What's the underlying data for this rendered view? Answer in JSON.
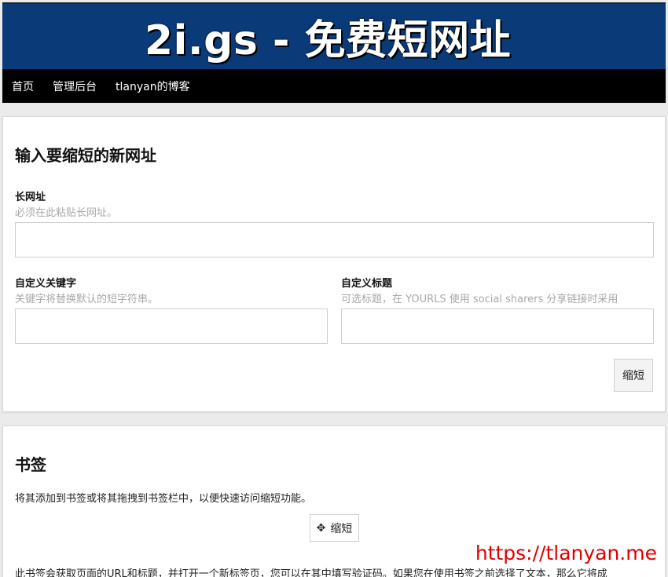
{
  "header": {
    "site_title": "2i.gs - 免费短网址",
    "nav": [
      "首页",
      "管理后台",
      "tlanyan的博客"
    ]
  },
  "shorten_form": {
    "heading": "输入要缩短的新网址",
    "long_url": {
      "label": "长网址",
      "help": "必须在此粘贴长网址。",
      "value": ""
    },
    "keyword": {
      "label": "自定义关键字",
      "help": "关键字将替换默认的短字符串。",
      "value": ""
    },
    "title": {
      "label": "自定义标题",
      "help": "可选标题，在 YOURLS 使用 social sharers 分享链接时采用",
      "value": ""
    },
    "submit_label": "缩短"
  },
  "bookmark": {
    "heading": "书签",
    "description": "将其添加到书签或将其拖拽到书签栏中，以便快速访问缩短功能。",
    "bookmarklet_label": "缩短",
    "bookmarklet_icon": "move-icon",
    "note": "此书签会获取页面的URL和标题，并打开一个新标签页，您可以在其中填写验证码。如果您在使用书签之前选择了文本，那么它将成"
  },
  "watermark": "https://tlanyan.me",
  "colors": {
    "banner": "#0a3a78",
    "navbar": "#000000",
    "watermark": "#e00000"
  }
}
